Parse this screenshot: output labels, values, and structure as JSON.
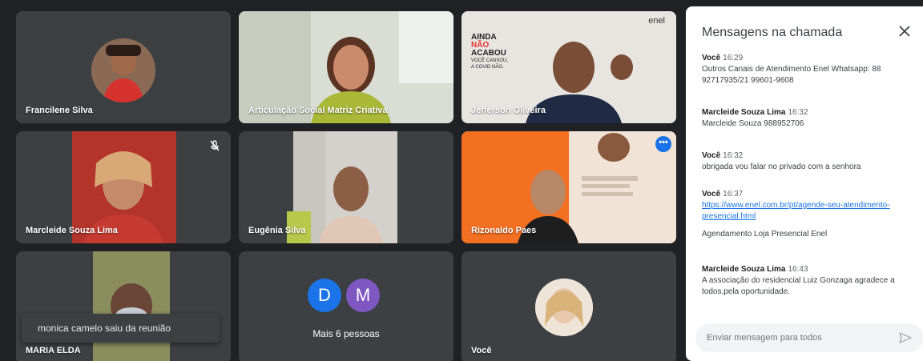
{
  "tiles": [
    {
      "name": "Francilene Silva"
    },
    {
      "name": "Articulação Social Matriz Criativa"
    },
    {
      "name": "Jefferson Oliveira"
    },
    {
      "name": "Marcleide Souza Lima"
    },
    {
      "name": "Eugênia Silva"
    },
    {
      "name": "Rizonaldo Paes"
    },
    {
      "name": "MARIA ELDA"
    },
    {
      "name": "Mais 6 pessoas"
    },
    {
      "name": "Você"
    }
  ],
  "jefferson_bg": {
    "logo": "enel",
    "line1": "AINDA",
    "line2": "NÃO",
    "line3": "ACABOU",
    "line4": "VOCÊ CANSOU,",
    "line5": "A COVID NÃO."
  },
  "more_people": {
    "letters": [
      "D",
      "M"
    ],
    "colors": [
      "#1a73e8",
      "#7e57c2"
    ]
  },
  "toast": "monica camelo saiu da reunião",
  "chat": {
    "title": "Mensagens na chamada",
    "messages": [
      {
        "sender": "Você",
        "time": "16:29",
        "text": "Outros Canais de Atendimento Enel Whatsapp: 88 92717935/21 99601-9608"
      },
      {
        "sender": "Marcleide Souza Lima",
        "time": "16:32",
        "text": "Marcleide Souza 988952706"
      },
      {
        "sender": "Você",
        "time": "16:32",
        "text": "obrigada vou falar no privado com a senhora"
      },
      {
        "sender": "Você",
        "time": "16:37",
        "link": "https://www.enel.com.br/pt/agende-seu-atendimento-presencial.html",
        "text": "Agendamento Loja Presencial Enel"
      },
      {
        "sender": "Marcleide Souza Lima",
        "time": "16:43",
        "text": "A associação do residencial Luiz Gonzaga agradece a todos,pela oportunidade."
      }
    ],
    "input_placeholder": "Enviar mensagem para todos"
  },
  "colors": {
    "accent": "#1a73e8",
    "tile_bg": "#3c4043",
    "page_bg": "#202124"
  }
}
